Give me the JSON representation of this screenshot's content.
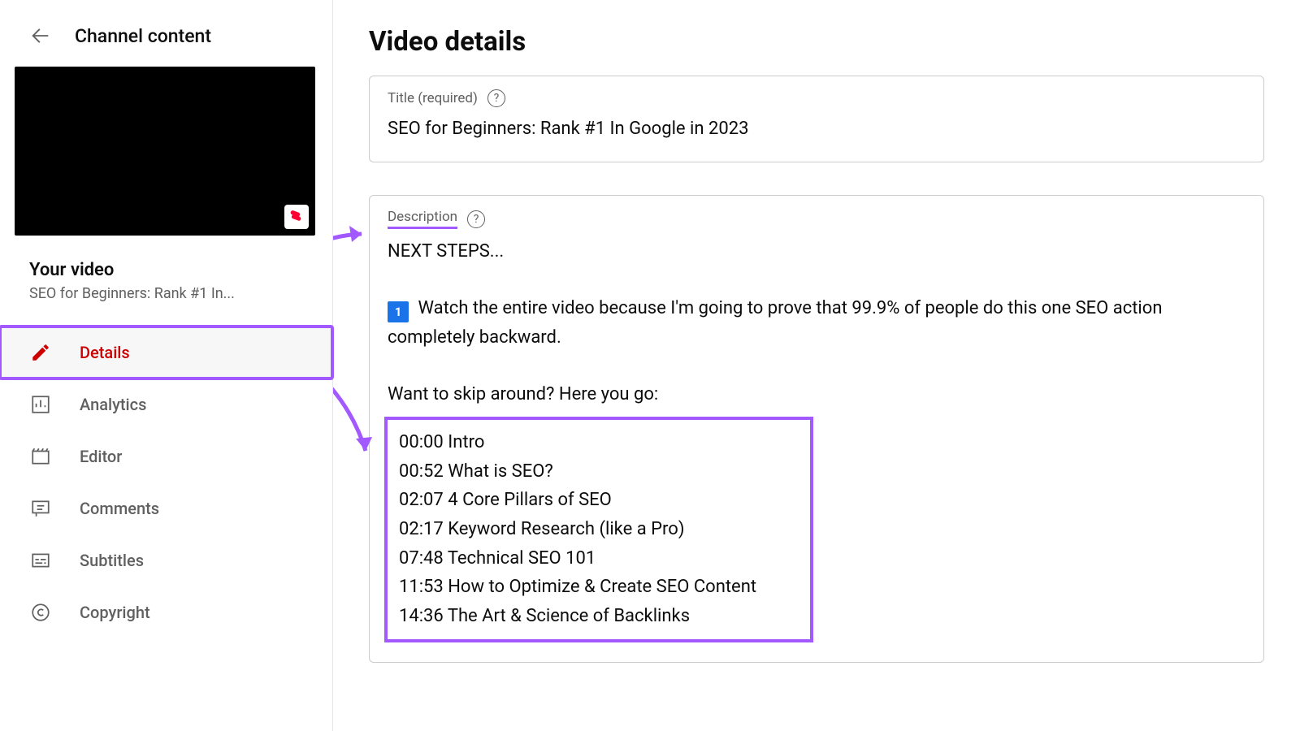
{
  "sidebar": {
    "back_label": "Back",
    "channel_content": "Channel content",
    "your_video_heading": "Your video",
    "video_title_truncated": "SEO for Beginners: Rank #1 In...",
    "nav": [
      {
        "key": "details",
        "label": "Details",
        "active": true
      },
      {
        "key": "analytics",
        "label": "Analytics",
        "active": false
      },
      {
        "key": "editor",
        "label": "Editor",
        "active": false
      },
      {
        "key": "comments",
        "label": "Comments",
        "active": false
      },
      {
        "key": "subtitles",
        "label": "Subtitles",
        "active": false
      },
      {
        "key": "copyright",
        "label": "Copyright",
        "active": false
      }
    ]
  },
  "main": {
    "page_title": "Video details",
    "title_field": {
      "label": "Title (required)",
      "value": "SEO for Beginners: Rank #1 In Google in 2023"
    },
    "description_field": {
      "label": "Description",
      "line1": "NEXT STEPS...",
      "bullet_icon": "1",
      "bullet_text": "Watch the entire video because I'm going to prove that 99.9% of people do this one SEO action completely backward.",
      "skip_prompt": "Want to skip around? Here you go:",
      "timestamps": [
        "00:00 Intro",
        "00:52 What is SEO?",
        "02:07 4 Core Pillars of SEO",
        "02:17 Keyword Research (like a Pro)",
        "07:48 Technical SEO 101",
        "11:53 How to Optimize & Create SEO Content",
        "14:36 The Art & Science of Backlinks"
      ]
    }
  },
  "annotations": {
    "highlight_color": "#a259ff"
  }
}
